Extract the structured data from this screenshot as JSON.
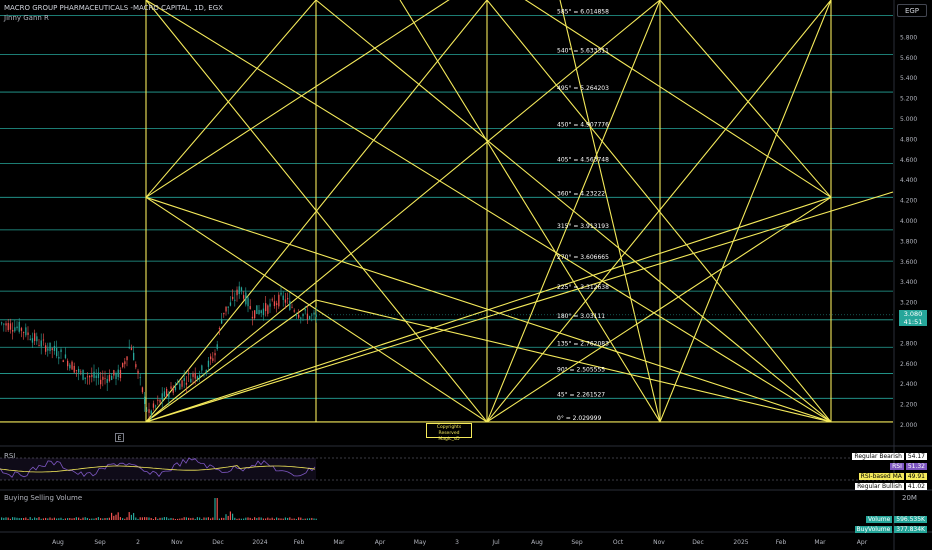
{
  "header": {
    "title": "MACRO GROUP PHARMACEUTICALS -MACRO CAPITAL, 1D, EGX",
    "indicator": "Jinny Gann R",
    "currency": "EGP"
  },
  "price_axis": {
    "ticks": [
      "5.800",
      "5.600",
      "5.400",
      "5.200",
      "5.000",
      "4.800",
      "4.600",
      "4.400",
      "4.200",
      "4.000",
      "3.800",
      "3.600",
      "3.400",
      "3.200",
      "3.000",
      "2.800",
      "2.600",
      "2.400",
      "2.200",
      "2.000"
    ],
    "last_price": "3.080",
    "countdown": "41:51"
  },
  "gann_levels": [
    "585° = 6.014858",
    "540° = 5.633311",
    "495° = 5.264203",
    "450° = 4.907776",
    "405° = 4.563748",
    "360° = 4.23222",
    "315° = 3.913193",
    "270° = 3.606665",
    "225° = 3.312638",
    "180° = 3.03111",
    "135° = 2.762083",
    "90° = 2.505555",
    "45° = 2.261527",
    "0° = 2.029999"
  ],
  "copyright": {
    "line1": "Copyrights Reserved",
    "line2": "Magic_sD"
  },
  "collapse_label": "E",
  "rsi_pane": {
    "label": "RSI",
    "legend": [
      {
        "name": "Regular Bearish",
        "value": "54.17",
        "bg": "#ffffff",
        "fg": "#000000"
      },
      {
        "name": "RSI",
        "value": "51.32",
        "bg": "#7e57c2",
        "fg": "#ffffff"
      },
      {
        "name": "RSI-based MA",
        "value": "49.91",
        "bg": "#f5ea5b",
        "fg": "#000000"
      },
      {
        "name": "Regular Bullish",
        "value": "41.02",
        "bg": "#ffffff",
        "fg": "#000000"
      }
    ]
  },
  "volume_pane": {
    "label": "Buying Selling Volume",
    "axis_top": "20M",
    "legend": [
      {
        "name": "Volume",
        "value": "596.535K"
      },
      {
        "name": "BuyVolume",
        "value": "377.834K"
      }
    ]
  },
  "time_axis": [
    "Aug",
    "Sep",
    "2",
    "Nov",
    "Dec",
    "2024",
    "Feb",
    "Mar",
    "Apr",
    "May",
    "3",
    "Jul",
    "Aug",
    "Sep",
    "Oct",
    "Nov",
    "Dec",
    "2025",
    "Feb",
    "Mar",
    "Apr"
  ],
  "colors": {
    "gann": "#f5ea5b",
    "level_line": "#26a69a",
    "bull": "#26a69a",
    "bear": "#ef5350",
    "price_badge": "#26a69a"
  }
}
